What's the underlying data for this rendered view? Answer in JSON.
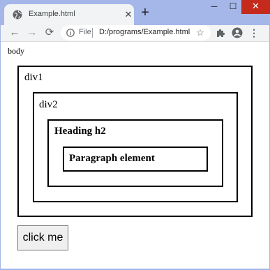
{
  "browser": {
    "tab_title": "Example.html",
    "tab_close_glyph": "✕",
    "new_tab_glyph": "+",
    "window_controls": {
      "minimize": "─",
      "maximize": "☐",
      "close": "✕"
    },
    "nav": {
      "back": "←",
      "forward": "→",
      "reload": "⟳"
    },
    "omnibox": {
      "scheme_label": "File",
      "url": "D:/programs/Example.html"
    },
    "star_glyph": "☆",
    "menu_glyph": "⋮",
    "icons": [
      "globe-icon",
      "info-icon",
      "star-icon",
      "puzzle-icon",
      "profile-icon",
      "menu-icon"
    ],
    "colors": {
      "frame": "#a5b6e8",
      "toolbar": "#f1f3f4",
      "close_button": "#c42b1c"
    }
  },
  "page": {
    "body_label": "body",
    "div1_label": "div1",
    "div2_label": "div2",
    "heading_label": "Heading h2",
    "paragraph_label": "Paragraph element",
    "button_label": "click me"
  }
}
